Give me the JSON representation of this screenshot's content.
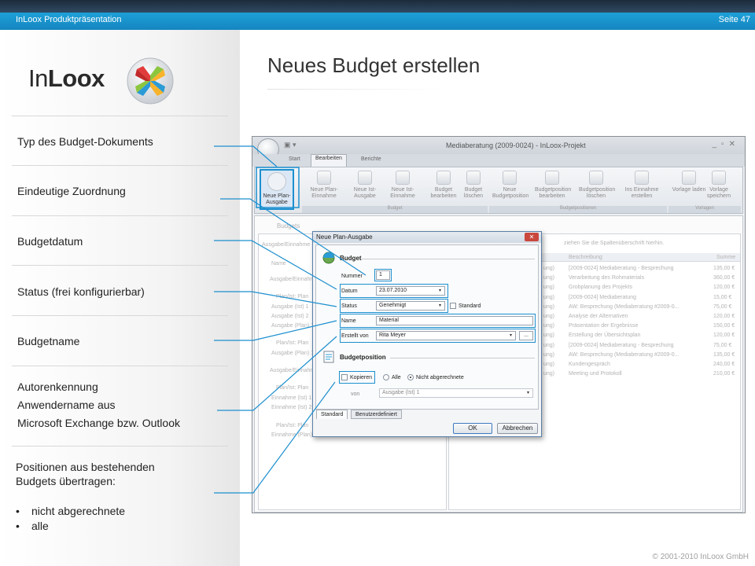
{
  "header": {
    "title": "InLoox Produktpräsentation",
    "page": "Seite 47"
  },
  "logo": {
    "text_regular": "In",
    "text_bold": "Loox"
  },
  "slide_title": "Neues Budget erstellen",
  "sidebar": {
    "items": [
      {
        "label": "Typ des Budget-Dokuments"
      },
      {
        "label": "Eindeutige Zuordnung"
      },
      {
        "label": "Budgetdatum"
      },
      {
        "label": "Status (frei konfigurierbar)"
      },
      {
        "label": "Budgetname"
      }
    ],
    "author": {
      "line1": "Autorenkennung",
      "line2": "Anwendername aus",
      "line3": "Microsoft Exchange bzw. Outlook"
    },
    "positions": {
      "line1": "Positionen aus bestehenden",
      "line2": "Budgets übertragen:",
      "bullets": [
        "nicht abgerechnete",
        "alle"
      ]
    }
  },
  "app": {
    "window_title": "Mediaberatung (2009-0024) - InLoox-Projekt",
    "tabs": [
      "Start",
      "Bearbeiten",
      "Berichte"
    ],
    "ribbon": {
      "buttons": [
        "Neue Plan-Ausgabe",
        "Neue Plan-Einnahme",
        "Neue Ist-Ausgabe",
        "Neue Ist-Einnahme",
        "Budget bearbeiten",
        "Budget löschen",
        "Neue Budgetposition",
        "Budgetposition bearbeiten",
        "Budgetposition löschen",
        "Ins Einnahme erstellen",
        "Vorlage laden",
        "Vorlage speichern"
      ],
      "groups": [
        "Budget",
        "Budgetpositionen",
        "Vorlagen"
      ]
    },
    "left_panel": {
      "header": "Budgets",
      "column": "Ausgabe/Einnahme",
      "name_col": "Name",
      "rows": [
        "Ausgabe/Einnahme",
        "Plan/Ist: Plan",
        "Ausgabe (Ist) 1",
        "Ausgabe (Ist) 2",
        "Ausgabe (Plan) 1",
        "Plan/Ist: Plan",
        "Ausgabe (Plan) 1",
        "Ausgabe/Einnahme",
        "Plan/Ist: Plan",
        "Einnahme (Ist) 1",
        "Einnahme (Ist) 2",
        "Plan/Ist: Plan",
        "Einnahme (Plan) 1"
      ]
    },
    "right_panel": {
      "hint": "ziehen Sie die Spaltenüberschrift hierhin.",
      "col_desc": "Beschreibung",
      "col_sum": "Summe",
      "rows": [
        {
          "desc": "[2009-0024] Mediaberatung - Besprechung",
          "sum": "135,00 €"
        },
        {
          "desc": "Verarbeitung des Rohmaterials",
          "sum": "360,00 €"
        },
        {
          "desc": "Grobplanung des Projekts",
          "sum": "120,00 €"
        },
        {
          "desc": "[2009-0024] Mediaberatung",
          "sum": "15,00 €"
        },
        {
          "desc": "AW: Besprechung  (Mediaberatung #2009-0...",
          "sum": "75,00 €"
        },
        {
          "desc": "Analyse der Alternativen",
          "sum": "120,00 €"
        },
        {
          "desc": "Präsentation der Ergebnisse",
          "sum": "150,00 €"
        },
        {
          "desc": "Erstellung der Übersichtsplan",
          "sum": "120,00 €"
        },
        {
          "desc": "[2009-0024] Mediaberatung - Besprechung",
          "sum": "75,00 €"
        },
        {
          "desc": "AW: Besprechung  (Mediaberatung #2009-0...",
          "sum": "135,00 €"
        },
        {
          "desc": "Kundengespräch",
          "sum": "240,00 €"
        },
        {
          "desc": "Meeting und Protokoll",
          "sum": "210,00 €"
        }
      ]
    }
  },
  "dialog": {
    "title": "Neue Plan-Ausgabe",
    "budget_section": "Budget",
    "nummer_label": "Nummer",
    "nummer_value": "1",
    "datum_label": "Datum",
    "datum_value": "23.07.2010",
    "status_label": "Status",
    "status_value": "Genehmigt",
    "standard_label": "Standard",
    "name_label": "Name",
    "name_value": "Material",
    "erstellt_label": "Erstellt von",
    "erstellt_value": "Rita Meyer",
    "more_button": "...",
    "pos_section": "Budgetposition",
    "kopieren_label": "Kopieren",
    "alle_label": "Alle",
    "nicht_label": "Nicht abgerechnete",
    "von_label": "von",
    "von_value": "Ausgabe (Ist) 1",
    "tab_standard": "Standard",
    "tab_custom": "Benutzerdefiniert",
    "ok": "OK",
    "cancel": "Abbrechen"
  },
  "footer": {
    "copyright": "© 2001-2010 InLoox GmbH"
  },
  "colors": {
    "accent": "#1c8fcf",
    "header_blue": "#1a96d0",
    "header_dark": "#22344a"
  }
}
